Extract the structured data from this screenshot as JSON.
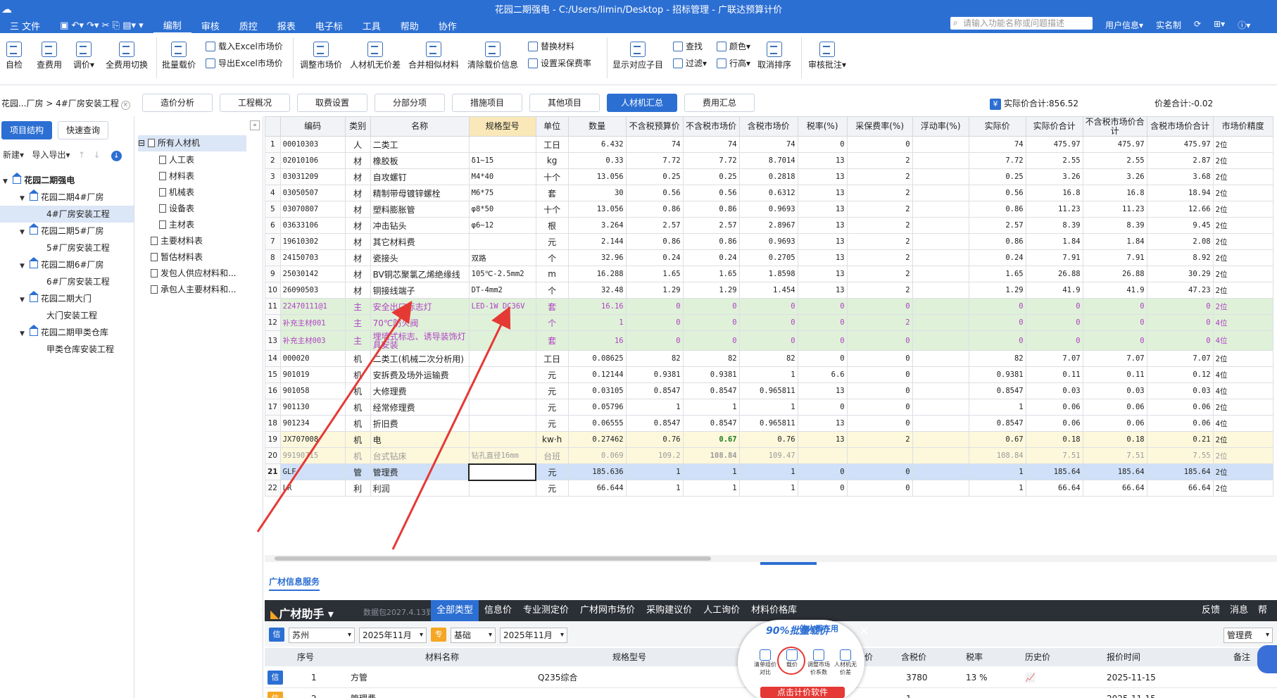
{
  "window": {
    "title": "花园二期强电 - C:/Users/limin/Desktop - 招标管理 - 广联达预算计价",
    "logo": "cloud-logo"
  },
  "menu": [
    "三 文件",
    "编制",
    "审核",
    "质控",
    "报表",
    "电子标",
    "工具",
    "帮助",
    "协作"
  ],
  "search": {
    "placeholder": "请输入功能名称或问题描述"
  },
  "topright": [
    "用户信息▾",
    "实名制",
    "⊞▾",
    "ⓘ▾"
  ],
  "ribbon": {
    "big": [
      "自检",
      "查费用",
      "调价▾",
      "全费用切换",
      "批量载价",
      "调整市场价",
      "人材机无价差",
      "合并相似材料",
      "清除载价信息",
      "显示对应子目",
      "取消排序",
      "审核批注▾"
    ],
    "small": [
      "载入Excel市场价",
      "导出Excel市场价",
      "替换材料",
      "设置采保费率",
      "查找",
      "颜色▾",
      "过滤▾",
      "行高▾"
    ]
  },
  "breadcrumb": {
    "text": "花园...厂房 > 4#厂房安装工程",
    "close": "×"
  },
  "tabs": [
    "造价分析",
    "工程概况",
    "取费设置",
    "分部分项",
    "措施项目",
    "其他项目",
    "人材机汇总",
    "费用汇总"
  ],
  "active_tab": "人材机汇总",
  "summary": {
    "actual": "实际价合计:856.52",
    "diff": "价差合计:-0.02",
    "icon": "¥"
  },
  "left": {
    "buttons": [
      "项目结构",
      "快速查询"
    ],
    "tools": [
      "新建▾",
      "导入导出▾",
      "↑",
      "↓",
      "↓"
    ],
    "tree": [
      "花园二期强电",
      "花园二期4#厂房",
      "4#厂房安装工程",
      "花园二期5#厂房",
      "5#厂房安装工程",
      "花园二期6#厂房",
      "6#厂房安装工程",
      "花园二期大门",
      "大门安装工程",
      "花园二期甲类仓库",
      "甲类仓库安装工程"
    ]
  },
  "mid": {
    "collapse": "«",
    "items": [
      "所有人材机",
      "人工表",
      "材料表",
      "机械表",
      "设备表",
      "主材表",
      "主要材料表",
      "暂估材料表",
      "发包人供应材料和...",
      "承包人主要材料和..."
    ]
  },
  "grid": {
    "headers": [
      "",
      "编码",
      "类别",
      "名称",
      "规格型号",
      "单位",
      "数量",
      "不含税预算价",
      "不含税市场价",
      "含税市场价",
      "税率(%)",
      "采保费率(%)",
      "浮动率(%)",
      "实际价",
      "实际价合计",
      "不含税市场价合计",
      "含税市场价合计",
      "市场价精度"
    ],
    "rows": [
      [
        "1",
        "00010303",
        "人",
        "二类工",
        "",
        "工日",
        "6.432",
        "74",
        "74",
        "74",
        "0",
        "0",
        "",
        "74",
        "475.97",
        "475.97",
        "475.97",
        "2位"
      ],
      [
        "2",
        "02010106",
        "材",
        "橡胶板",
        "δ1~15",
        "kg",
        "0.33",
        "7.72",
        "7.72",
        "8.7014",
        "13",
        "2",
        "",
        "7.72",
        "2.55",
        "2.55",
        "2.87",
        "2位"
      ],
      [
        "3",
        "03031209",
        "材",
        "自攻螺钉",
        "M4*40",
        "十个",
        "13.056",
        "0.25",
        "0.25",
        "0.2818",
        "13",
        "2",
        "",
        "0.25",
        "3.26",
        "3.26",
        "3.68",
        "2位"
      ],
      [
        "4",
        "03050507",
        "材",
        "精制带母镀锌螺栓",
        "M6*75",
        "套",
        "30",
        "0.56",
        "0.56",
        "0.6312",
        "13",
        "2",
        "",
        "0.56",
        "16.8",
        "16.8",
        "18.94",
        "2位"
      ],
      [
        "5",
        "03070807",
        "材",
        "塑料膨胀管",
        "φ8*50",
        "十个",
        "13.056",
        "0.86",
        "0.86",
        "0.9693",
        "13",
        "2",
        "",
        "0.86",
        "11.23",
        "11.23",
        "12.66",
        "2位"
      ],
      [
        "6",
        "03633106",
        "材",
        "冲击钻头",
        "φ6~12",
        "根",
        "3.264",
        "2.57",
        "2.57",
        "2.8967",
        "13",
        "2",
        "",
        "2.57",
        "8.39",
        "8.39",
        "9.45",
        "2位"
      ],
      [
        "7",
        "19610302",
        "材",
        "其它材料费",
        "",
        "元",
        "2.144",
        "0.86",
        "0.86",
        "0.9693",
        "13",
        "2",
        "",
        "0.86",
        "1.84",
        "1.84",
        "2.08",
        "2位"
      ],
      [
        "8",
        "24150703",
        "材",
        "瓷接头",
        "双路",
        "个",
        "32.96",
        "0.24",
        "0.24",
        "0.2705",
        "13",
        "2",
        "",
        "0.24",
        "7.91",
        "7.91",
        "8.92",
        "2位"
      ],
      [
        "9",
        "25030142",
        "材",
        "BV铜芯聚氯乙烯绝缘线",
        "105℃-2.5mm2",
        "m",
        "16.288",
        "1.65",
        "1.65",
        "1.8598",
        "13",
        "2",
        "",
        "1.65",
        "26.88",
        "26.88",
        "30.29",
        "2位"
      ],
      [
        "10",
        "26090503",
        "材",
        "铜接线端子",
        "DT-4mm2",
        "个",
        "32.48",
        "1.29",
        "1.29",
        "1.454",
        "13",
        "2",
        "",
        "1.29",
        "41.9",
        "41.9",
        "47.23",
        "2位"
      ],
      [
        "11",
        "22470111@1",
        "主",
        "安全出口标志灯",
        "LED-1W DC36V",
        "套",
        "16.16",
        "0",
        "0",
        "0",
        "0",
        "0",
        "",
        "0",
        "0",
        "0",
        "0",
        "2位"
      ],
      [
        "12",
        "补充主材001",
        "主",
        "70℃防火阀",
        "",
        "个",
        "1",
        "0",
        "0",
        "0",
        "0",
        "2",
        "",
        "0",
        "0",
        "0",
        "0",
        "4位"
      ],
      [
        "13",
        "补充主材003",
        "主",
        "埋墙式标志、诱导装饰灯具安装",
        "",
        "套",
        "16",
        "0",
        "0",
        "0",
        "0",
        "0",
        "",
        "0",
        "0",
        "0",
        "0",
        "4位"
      ],
      [
        "14",
        "000020",
        "机",
        "二类工(机械二次分析用)",
        "",
        "工日",
        "0.08625",
        "82",
        "82",
        "82",
        "0",
        "0",
        "",
        "82",
        "7.07",
        "7.07",
        "7.07",
        "2位"
      ],
      [
        "15",
        "901019",
        "机",
        "安拆费及场外运输费",
        "",
        "元",
        "0.12144",
        "0.9381",
        "0.9381",
        "1",
        "6.6",
        "0",
        "",
        "0.9381",
        "0.11",
        "0.11",
        "0.12",
        "4位"
      ],
      [
        "16",
        "901058",
        "机",
        "大修理费",
        "",
        "元",
        "0.03105",
        "0.8547",
        "0.8547",
        "0.965811",
        "13",
        "0",
        "",
        "0.8547",
        "0.03",
        "0.03",
        "0.03",
        "4位"
      ],
      [
        "17",
        "901130",
        "机",
        "经常修理费",
        "",
        "元",
        "0.05796",
        "1",
        "1",
        "1",
        "0",
        "0",
        "",
        "1",
        "0.06",
        "0.06",
        "0.06",
        "2位"
      ],
      [
        "18",
        "901234",
        "机",
        "折旧费",
        "",
        "元",
        "0.06555",
        "0.8547",
        "0.8547",
        "0.965811",
        "13",
        "0",
        "",
        "0.8547",
        "0.06",
        "0.06",
        "0.06",
        "4位"
      ],
      [
        "19",
        "JX707008",
        "机",
        "电",
        "",
        "kw·h",
        "0.27462",
        "0.76",
        "0.67",
        "0.76",
        "13",
        "2",
        "",
        "0.67",
        "0.18",
        "0.18",
        "0.21",
        "2位"
      ],
      [
        "20",
        "99190715",
        "机",
        "台式钻床",
        "钻孔直径16mm",
        "台班",
        "0.069",
        "109.2",
        "108.84",
        "109.47",
        "",
        "",
        "",
        "108.84",
        "7.51",
        "7.51",
        "7.55",
        "2位"
      ],
      [
        "21",
        "GLF",
        "管",
        "管理费",
        "",
        "元",
        "185.636",
        "1",
        "1",
        "1",
        "0",
        "0",
        "",
        "1",
        "185.64",
        "185.64",
        "185.64",
        "2位"
      ],
      [
        "22",
        "LR",
        "利",
        "利润",
        "",
        "元",
        "66.644",
        "1",
        "1",
        "1",
        "0",
        "0",
        "",
        "1",
        "66.64",
        "66.64",
        "66.64",
        "2位"
      ]
    ]
  },
  "bottom": {
    "panel_title": "广材信息服务",
    "brand": "广材助手",
    "package": "数据包2027.4.13到期",
    "tabs": [
      "全部类型",
      "信息价",
      "专业测定价",
      "广材网市场价",
      "采购建议价",
      "人工询价",
      "材料价格库"
    ],
    "right": [
      "反馈",
      "消息",
      "帮"
    ],
    "filters": {
      "badge1": "信",
      "region": "苏州",
      "period1": "2025年11月",
      "badge2": "专",
      "type": "基础",
      "period2": "2025年11月",
      "search": "管理费"
    },
    "headers": [
      "序号",
      "材料名称",
      "规格型号",
      "价",
      "含税价",
      "税率",
      "历史价",
      "报价时间",
      "备注"
    ],
    "rows": [
      {
        "badge": "信",
        "no": "1",
        "name": "方管",
        "spec": "Q235综合",
        "price": "3780",
        "rate": "13 %",
        "time": "2025-11-15"
      },
      {
        "badge": "信",
        "no": "2",
        "name": "管理费",
        "spec": "",
        "price": "1",
        "rate": "",
        "time": "2025-11-15"
      }
    ]
  },
  "popup": {
    "top": "的人都在用",
    "big": "90%",
    "banner": "批量载价",
    "items": [
      "清单组价对比",
      "载价",
      "调整市场价系数",
      "人材机无价差"
    ],
    "cta": "点击计价软件",
    "close": "×"
  },
  "colors": {
    "accent": "#2c6fd3",
    "main_row": "#dff1d9",
    "main_text": "#b043c4",
    "arrow": "#e53935"
  }
}
